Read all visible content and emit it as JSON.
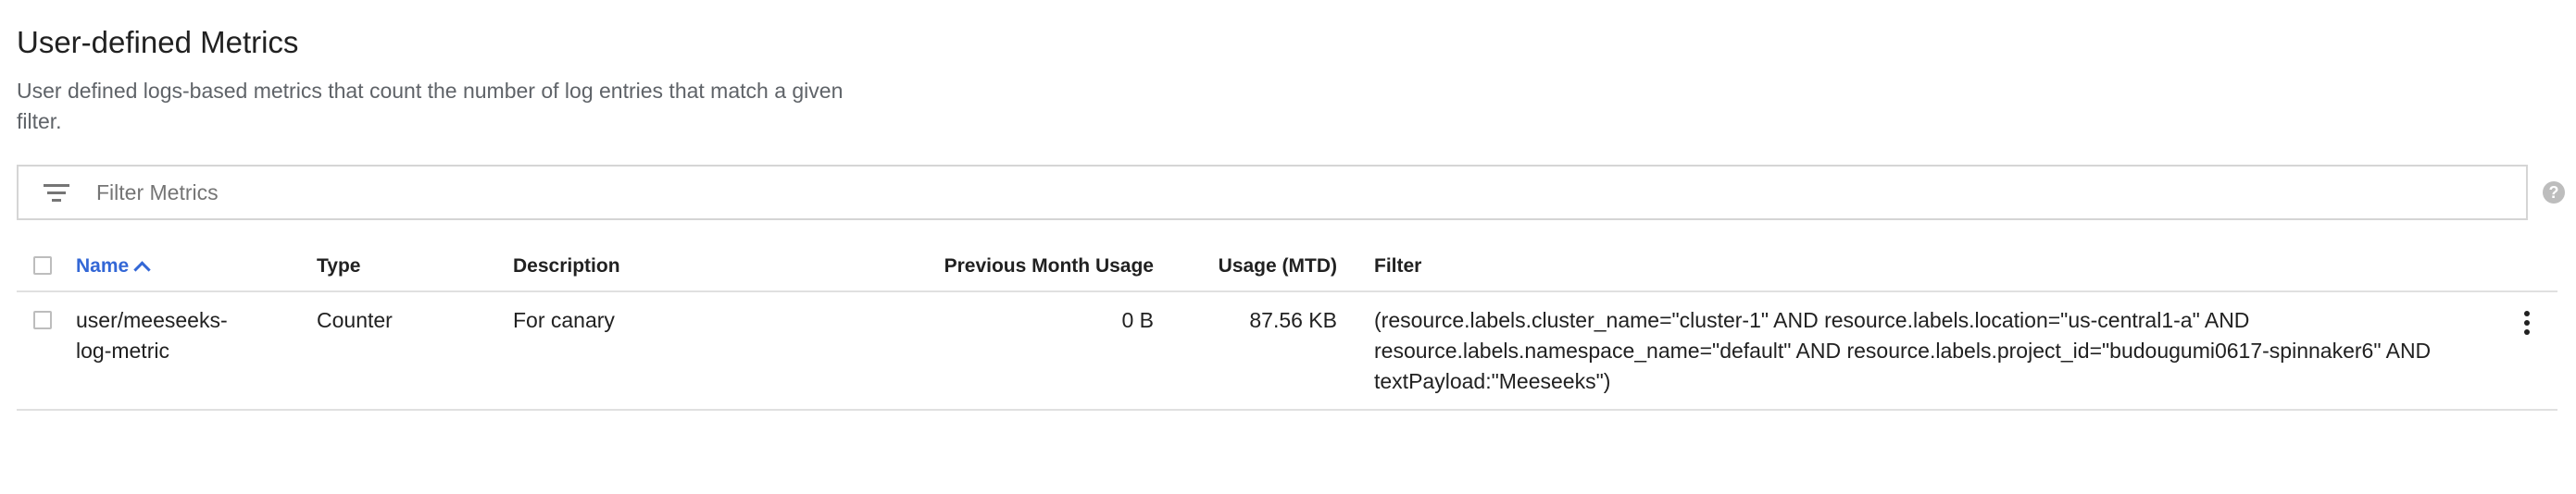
{
  "page": {
    "title": "User-defined Metrics",
    "subtitle": "User defined logs-based metrics that count the number of log entries that match a given filter."
  },
  "filter": {
    "placeholder": "Filter Metrics",
    "value": "",
    "icon": "filter-list-icon",
    "help_icon": "help-icon",
    "help_glyph": "?"
  },
  "table": {
    "columns": {
      "name": "Name",
      "type": "Type",
      "description": "Description",
      "previous_month_usage": "Previous Month Usage",
      "usage_mtd": "Usage (MTD)",
      "filter": "Filter"
    },
    "sort": {
      "column": "name",
      "direction": "ascending"
    },
    "rows": [
      {
        "name": "user/meeseeks-log-metric",
        "type": "Counter",
        "description": "For canary",
        "previous_month_usage": "0 B",
        "usage_mtd": "87.56 KB",
        "filter": "(resource.labels.cluster_name=\"cluster-1\" AND resource.labels.location=\"us-central1-a\" AND resource.labels.namespace_name=\"default\" AND resource.labels.project_id=\"budougumi0617-spinnaker6\" AND textPayload:\"Meeseeks\")",
        "checked": false
      }
    ]
  },
  "colors": {
    "accent": "#3367d6",
    "text": "#212121",
    "muted": "#5f6368",
    "border": "#e0e0e0"
  }
}
